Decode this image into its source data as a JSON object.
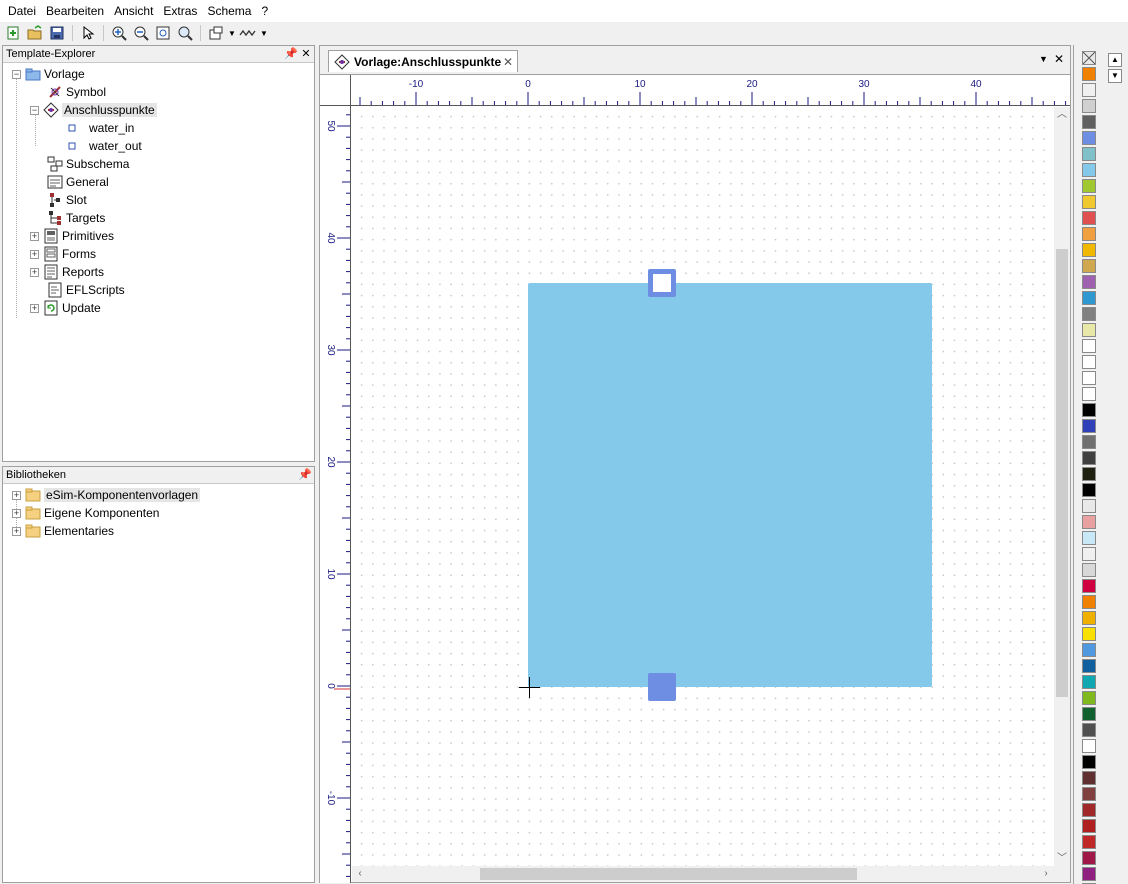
{
  "menu": {
    "items": [
      "Datei",
      "Bearbeiten",
      "Ansicht",
      "Extras",
      "Schema",
      "?"
    ]
  },
  "template_explorer": {
    "title": "Template-Explorer",
    "root": "Vorlage",
    "items": [
      "Symbol",
      "Anschlusspunkte",
      "Subschema",
      "General",
      "Slot",
      "Targets",
      "Primitives",
      "Forms",
      "Reports",
      "EFLScripts",
      "Update"
    ],
    "ports": [
      "water_in",
      "water_out"
    ]
  },
  "libraries": {
    "title": "Bibliotheken",
    "items": [
      "eSim-Komponentenvorlagen",
      "Eigene Komponenten",
      "Elementaries"
    ]
  },
  "document": {
    "tab_title": "Vorlage:Anschlusspunkte",
    "ruler_x_labels": [
      "-10",
      "0",
      "10",
      "20",
      "30",
      "40"
    ],
    "ruler_y_labels": [
      "50",
      "40",
      "30",
      "20",
      "10",
      "0",
      "-10"
    ]
  },
  "colors": {
    "shape_fill": "#84c8ea",
    "port_color": "#6e8ee4",
    "palette": [
      "#e8e8e8",
      "#f08000",
      "#f0f0f0",
      "#d0d0d0",
      "#606060",
      "#6e8ee4",
      "#80c0c8",
      "#84c8ea",
      "#a0c830",
      "#f0c830",
      "#e05050",
      "#f0a040",
      "#f0b800",
      "#d0a850",
      "#a060b0",
      "#3098d0",
      "#808080",
      "#e8e8a8",
      "#ffffff",
      "#ffffff",
      "#ffffff",
      "#ffffff",
      "#000000",
      "#3040b8",
      "#707070",
      "#404040",
      "#202010",
      "#000000",
      "#e8e8e8",
      "#e8a0a0",
      "#c8e8f8",
      "#f0f0f0",
      "#d8d8d8",
      "#d00040",
      "#f08000",
      "#f0b000",
      "#f8e000",
      "#5098e0",
      "#1060a0",
      "#10a8b0",
      "#80b820",
      "#106030",
      "#505050",
      "#ffffff",
      "#000000",
      "#603030",
      "#804040",
      "#a02828",
      "#b02020",
      "#c02828",
      "#a01848",
      "#902080",
      "#f00080"
    ]
  }
}
